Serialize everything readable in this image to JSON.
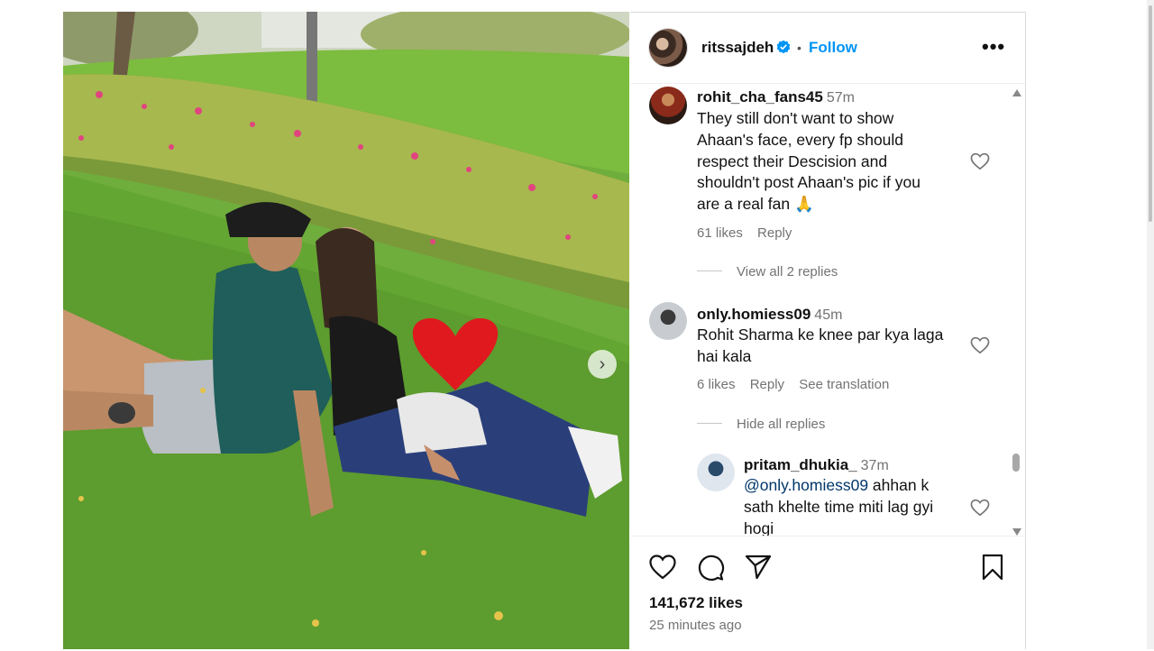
{
  "post": {
    "author": "ritssajdeh",
    "follow_label": "Follow",
    "dot": "•",
    "more_label": "•••",
    "next_label": "›"
  },
  "comments": [
    {
      "user": "rohit_cha_fans45",
      "time": "57m",
      "lines": [
        "They still don't want to show",
        "Ahaan's face, every fp should",
        "respect their Descision and",
        "shouldn't post Ahaan's pic if you",
        "are a real fan 🙏"
      ],
      "likes": "61 likes",
      "reply": "Reply",
      "replies_toggle": "View all 2 replies"
    },
    {
      "user": "only.homiess09",
      "time": "45m",
      "lines": [
        "Rohit Sharma ke knee par kya laga",
        "hai kala"
      ],
      "likes": "6 likes",
      "reply": "Reply",
      "translate": "See translation",
      "replies_toggle": "Hide all replies"
    },
    {
      "user": "pritam_dhukia_",
      "time": "37m",
      "mention": "@only.homiess09",
      "line1_rest": " ahhan k",
      "lines": [
        "sath khelte time miti lag gyi",
        "hogi"
      ]
    }
  ],
  "footer": {
    "likes": "141,672 likes",
    "time_ago": "25 minutes ago"
  },
  "colors": {
    "accent": "#0095f6",
    "muted": "#737373",
    "verified": "#0095f6"
  },
  "icons": [
    "heart-icon",
    "comment-icon",
    "share-icon",
    "bookmark-icon",
    "verified-icon",
    "more-icon",
    "chevron-right-icon"
  ]
}
